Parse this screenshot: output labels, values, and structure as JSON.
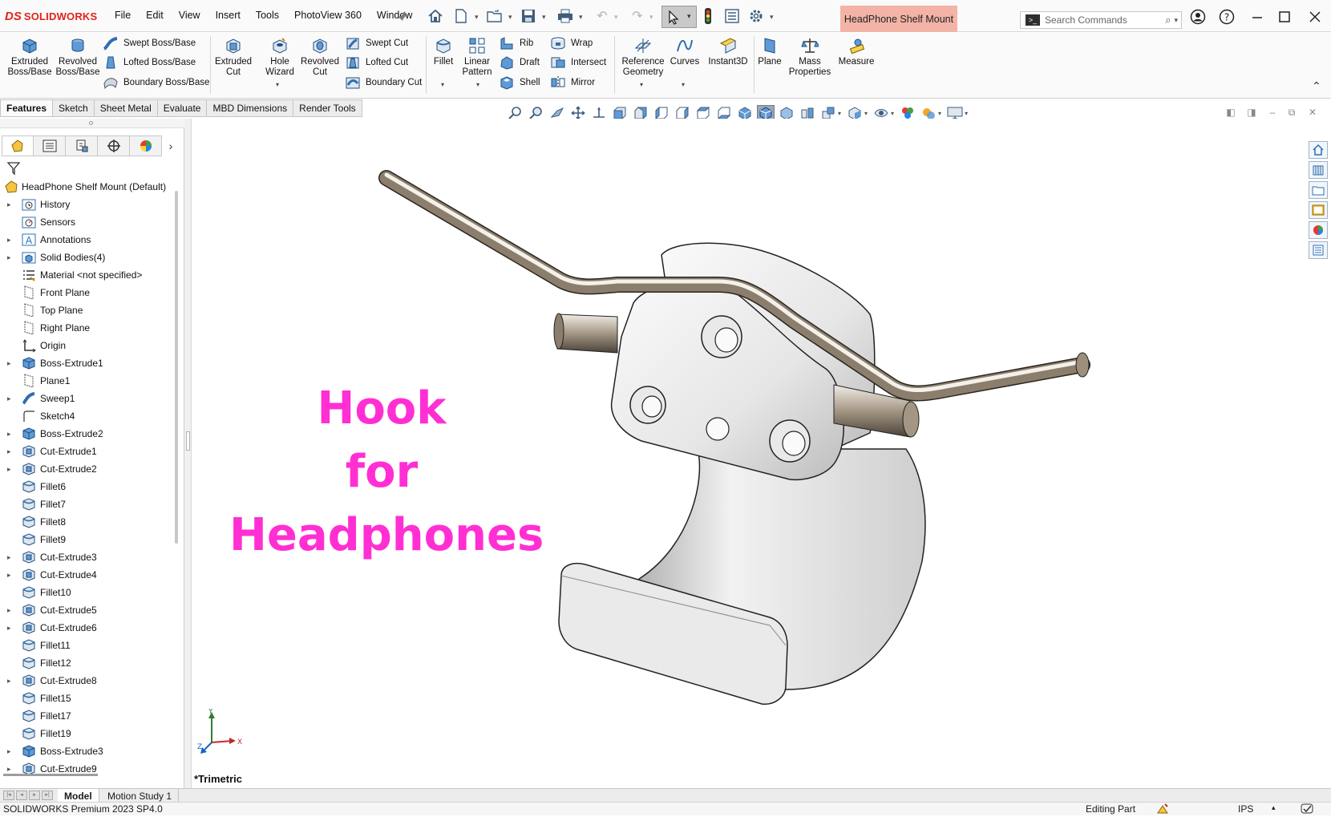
{
  "app": {
    "brand_prefix": "DS",
    "brand_name": "SOLIDWORKS"
  },
  "menu": [
    "File",
    "Edit",
    "View",
    "Insert",
    "Tools",
    "PhotoView 360",
    "Window"
  ],
  "document_title": "HeadPhone Shelf Mount",
  "search": {
    "placeholder": "Search Commands"
  },
  "command_manager": {
    "extruded_boss": "Extruded Boss/Base",
    "revolved_boss": "Revolved Boss/Base",
    "swept_boss": "Swept Boss/Base",
    "lofted_boss": "Lofted Boss/Base",
    "boundary_boss": "Boundary Boss/Base",
    "extruded_cut": "Extruded Cut",
    "hole_wizard": "Hole Wizard",
    "revolved_cut": "Revolved Cut",
    "swept_cut": "Swept Cut",
    "lofted_cut": "Lofted Cut",
    "boundary_cut": "Boundary Cut",
    "fillet": "Fillet",
    "linear_pattern": "Linear Pattern",
    "rib": "Rib",
    "draft": "Draft",
    "shell": "Shell",
    "wrap": "Wrap",
    "intersect": "Intersect",
    "mirror": "Mirror",
    "reference_geometry": "Reference Geometry",
    "curves": "Curves",
    "instant3d": "Instant3D",
    "plane": "Plane",
    "mass_properties": "Mass Properties",
    "measure": "Measure"
  },
  "tabs": [
    "Features",
    "Sketch",
    "Sheet Metal",
    "Evaluate",
    "MBD Dimensions",
    "Render Tools"
  ],
  "feature_tree": {
    "root": "HeadPhone Shelf Mount  (Default)",
    "items": [
      {
        "label": "History",
        "icon": "history-folder-icon",
        "expand": true
      },
      {
        "label": "Sensors",
        "icon": "sensors-icon",
        "expand": false
      },
      {
        "label": "Annotations",
        "icon": "annotations-icon",
        "expand": true
      },
      {
        "label": "Solid Bodies(4)",
        "icon": "solid-bodies-icon",
        "expand": true
      },
      {
        "label": "Material <not specified>",
        "icon": "material-icon",
        "expand": false
      },
      {
        "label": "Front Plane",
        "icon": "plane-icon",
        "expand": false
      },
      {
        "label": "Top Plane",
        "icon": "plane-icon",
        "expand": false
      },
      {
        "label": "Right Plane",
        "icon": "plane-icon",
        "expand": false
      },
      {
        "label": "Origin",
        "icon": "origin-icon",
        "expand": false
      },
      {
        "label": "Boss-Extrude1",
        "icon": "boss-extrude-icon",
        "expand": true
      },
      {
        "label": "Plane1",
        "icon": "plane-icon",
        "expand": false
      },
      {
        "label": "Sweep1",
        "icon": "sweep-icon",
        "expand": true
      },
      {
        "label": "Sketch4",
        "icon": "sketch-icon",
        "expand": false
      },
      {
        "label": "Boss-Extrude2",
        "icon": "boss-extrude-icon",
        "expand": true
      },
      {
        "label": "Cut-Extrude1",
        "icon": "cut-extrude-icon",
        "expand": true
      },
      {
        "label": "Cut-Extrude2",
        "icon": "cut-extrude-icon",
        "expand": true
      },
      {
        "label": "Fillet6",
        "icon": "fillet-icon",
        "expand": false
      },
      {
        "label": "Fillet7",
        "icon": "fillet-icon",
        "expand": false
      },
      {
        "label": "Fillet8",
        "icon": "fillet-icon",
        "expand": false
      },
      {
        "label": "Fillet9",
        "icon": "fillet-icon",
        "expand": false
      },
      {
        "label": "Cut-Extrude3",
        "icon": "cut-extrude-icon",
        "expand": true
      },
      {
        "label": "Cut-Extrude4",
        "icon": "cut-extrude-icon",
        "expand": true
      },
      {
        "label": "Fillet10",
        "icon": "fillet-icon",
        "expand": false
      },
      {
        "label": "Cut-Extrude5",
        "icon": "cut-extrude-icon",
        "expand": true
      },
      {
        "label": "Cut-Extrude6",
        "icon": "cut-extrude-icon",
        "expand": true
      },
      {
        "label": "Fillet11",
        "icon": "fillet-icon",
        "expand": false
      },
      {
        "label": "Fillet12",
        "icon": "fillet-icon",
        "expand": false
      },
      {
        "label": "Cut-Extrude8",
        "icon": "cut-extrude-icon",
        "expand": true
      },
      {
        "label": "Fillet15",
        "icon": "fillet-icon",
        "expand": false
      },
      {
        "label": "Fillet17",
        "icon": "fillet-icon",
        "expand": false
      },
      {
        "label": "Fillet19",
        "icon": "fillet-icon",
        "expand": false
      },
      {
        "label": "Boss-Extrude3",
        "icon": "boss-extrude-icon",
        "expand": true
      },
      {
        "label": "Cut-Extrude9",
        "icon": "cut-extrude-icon",
        "expand": true
      }
    ]
  },
  "graphics": {
    "overlay_lines": [
      "Hook",
      "for",
      "Headphones"
    ],
    "overlay_color": "#ff2fd3",
    "view_name": "*Trimetric",
    "triad": {
      "y": "Y",
      "x": "X",
      "z": "Z"
    }
  },
  "bottom_tabs": [
    "Model",
    "Motion Study 1"
  ],
  "status": {
    "product": "SOLIDWORKS Premium 2023 SP4.0",
    "mode": "Editing Part",
    "units": "IPS"
  },
  "colors": {
    "accent_red": "#e2231a",
    "doc_title_bg": "#f3b3a6",
    "icon_blue": "#2f6fb3"
  }
}
